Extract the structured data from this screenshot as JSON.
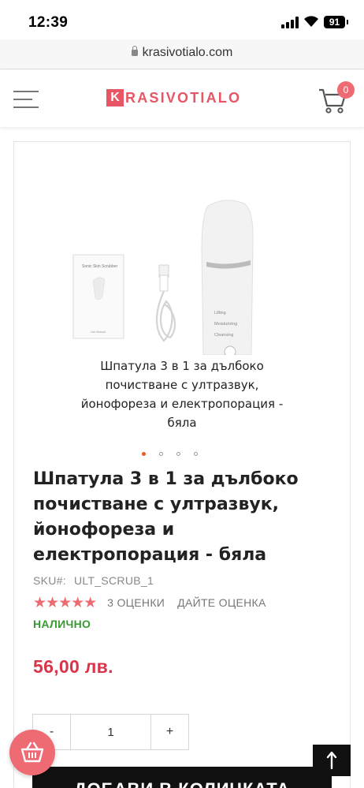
{
  "status_bar": {
    "time": "12:39",
    "battery": "91"
  },
  "browser": {
    "url": "krasivotialo.com"
  },
  "header": {
    "logo_letter": "K",
    "logo_rest": "RASIVOTIALO",
    "cart_count": "0"
  },
  "product": {
    "image_caption": "Шпатула 3 в 1 за дълбоко почистване с ултразвук, йонофореза и електропорация - бяла",
    "box_label": "Sonic Skin Scrubber",
    "box_sublabel": "Use Manual",
    "device_labels": [
      "Lifting",
      "Moisturizing",
      "Cleansing"
    ],
    "slides_total": 4,
    "slide_active": 0,
    "title": "Шпатула 3 в 1 за дълбоко почистване с ултразвук, йонофореза и електропорация - бяла",
    "sku_label": "SKU#:",
    "sku_value": "ULT_SCRUB_1",
    "rating_stars": 5,
    "rating_stars_text": "★★★★★",
    "rating_count": "3  ОЦЕНКИ",
    "add_rating": "ДАЙТЕ ОЦЕНКА",
    "stock": "НАЛИЧНО",
    "price": "56,00 лв.",
    "quantity": "1",
    "qty_minus": "-",
    "qty_plus": "+",
    "add_to_cart": "ДОБАВИ В КОЛИЧКАТА"
  },
  "colors": {
    "accent": "#ef6b74",
    "logo": "#e85565",
    "price": "#d8344a",
    "stock": "#3a9a32"
  }
}
